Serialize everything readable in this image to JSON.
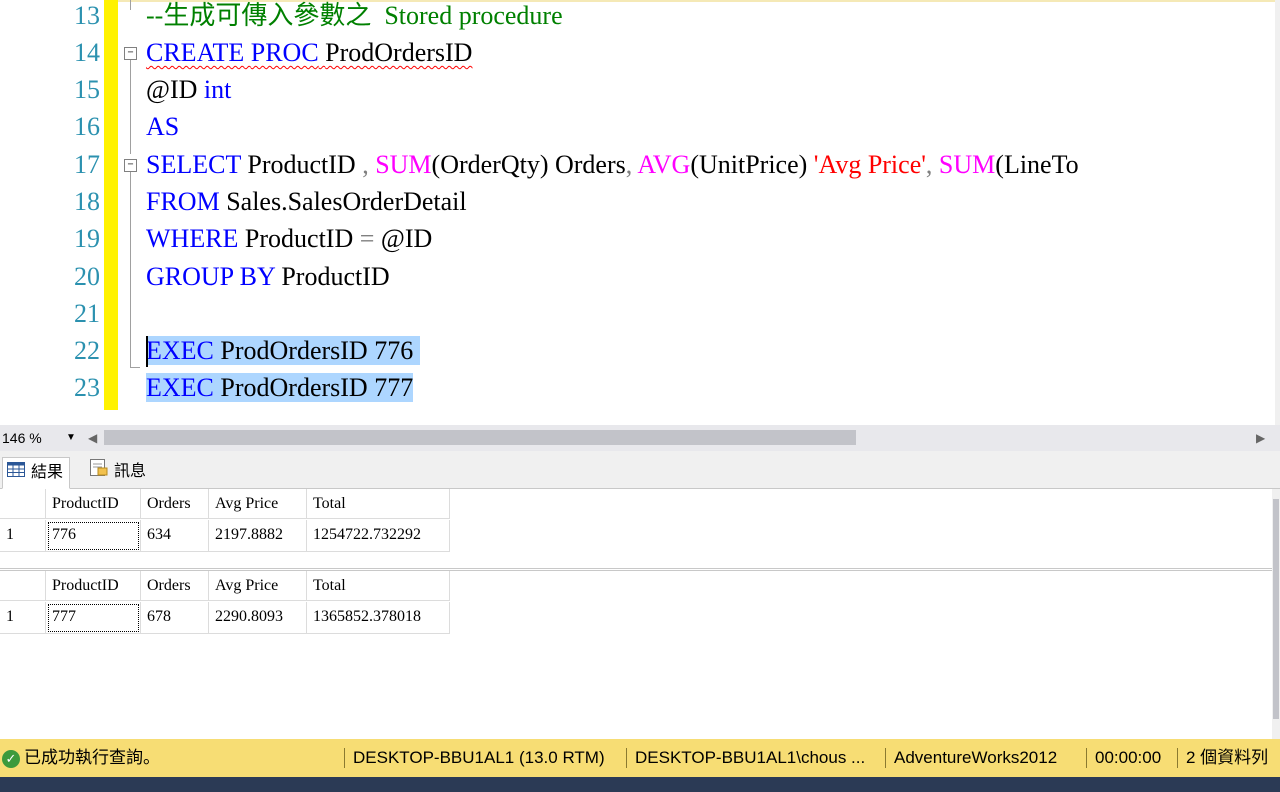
{
  "editor": {
    "line_numbers": [
      "13",
      "14",
      "15",
      "16",
      "17",
      "18",
      "19",
      "20",
      "21",
      "22",
      "23"
    ],
    "line13": {
      "comment": "--生成可傳入參數之  Stored procedure"
    },
    "line14": {
      "kw1": "CREATE",
      "kw2": "PROC",
      "name": "ProdOrdersID"
    },
    "line15": {
      "param": "@ID",
      "type": "int"
    },
    "line16": {
      "kw": "AS"
    },
    "line17": {
      "kw": "SELECT",
      "t1": " ProductID ",
      "comma1": ",",
      "fn1": "SUM",
      "t2": "(OrderQty) Orders",
      "comma2": ",",
      "fn2": "AVG",
      "t3": "(UnitPrice) ",
      "str": "'Avg Price'",
      "comma3": ",",
      "fn3": "SUM",
      "t4": "(LineTo"
    },
    "line18": {
      "kw": "FROM",
      "t": " Sales.SalesOrderDetail"
    },
    "line19": {
      "kw": "WHERE",
      "t1": " ProductID ",
      "op": "=",
      "t2": " @ID"
    },
    "line20": {
      "kw1": "GROUP",
      "kw2": "BY",
      "t": " ProductID"
    },
    "line22": {
      "kw": "EXEC",
      "t": " ProdOrdersID 776"
    },
    "line23": {
      "kw": "EXEC",
      "t": " ProdOrdersID 777"
    }
  },
  "zoom": {
    "value": "146 %"
  },
  "tabs": [
    {
      "label": "結果",
      "icon": "grid-icon"
    },
    {
      "label": "訊息",
      "icon": "message-icon"
    }
  ],
  "results": [
    {
      "columns": [
        "ProductID",
        "Orders",
        "Avg Price",
        "Total"
      ],
      "rows": [
        {
          "num": "1",
          "cells": [
            "776",
            "634",
            "2197.8882",
            "1254722.732292"
          ]
        }
      ]
    },
    {
      "columns": [
        "ProductID",
        "Orders",
        "Avg Price",
        "Total"
      ],
      "rows": [
        {
          "num": "1",
          "cells": [
            "777",
            "678",
            "2290.8093",
            "1365852.378018"
          ]
        }
      ]
    }
  ],
  "status": {
    "message": "已成功執行查詢。",
    "server": "DESKTOP-BBU1AL1 (13.0 RTM)",
    "user": "DESKTOP-BBU1AL1\\chous ...",
    "database": "AdventureWorks2012",
    "elapsed": "00:00:00",
    "rows": "2 個資料列"
  },
  "colors": {
    "keyword": "#0000ff",
    "function": "#ff00ff",
    "string": "#ff0000",
    "comment": "#008000",
    "line_number": "#2b91af",
    "selection": "#add6ff",
    "status_bar": "#f7dd74"
  }
}
